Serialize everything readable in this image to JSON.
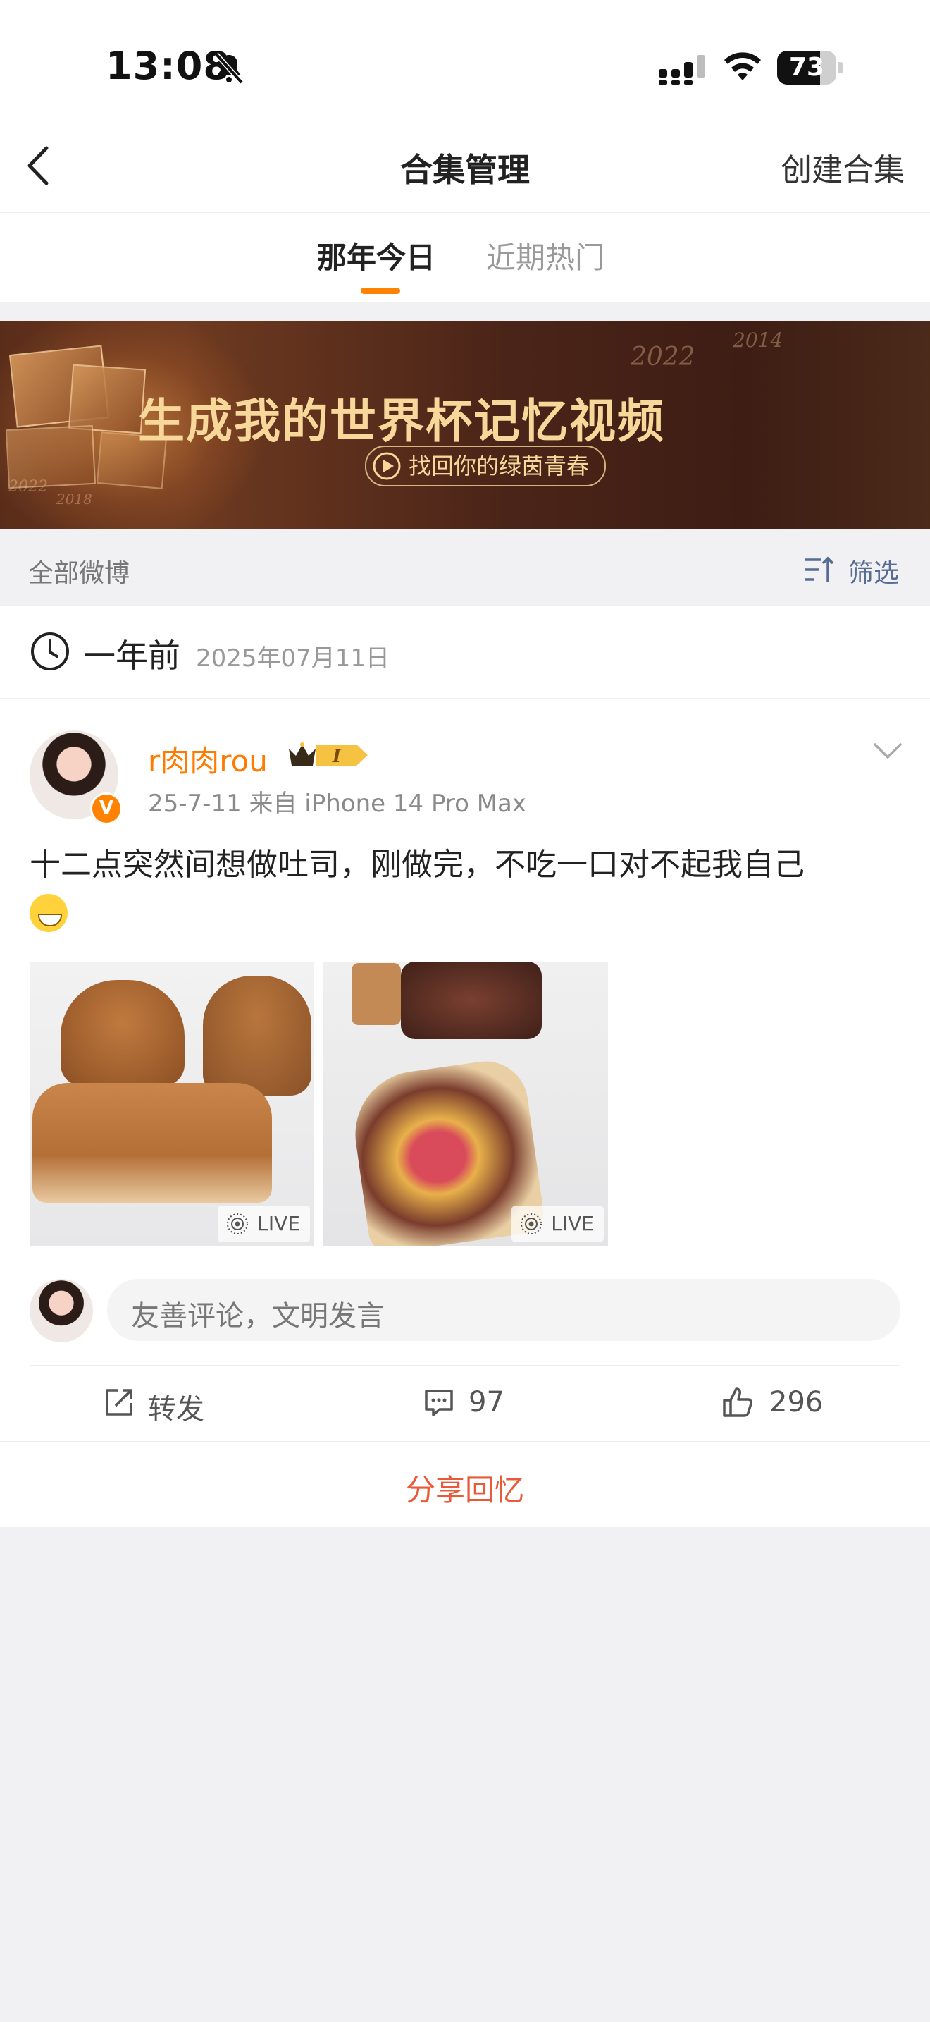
{
  "status_bar": {
    "time": "13:08",
    "battery": "73",
    "battery_level": 0.73,
    "icons": [
      "bell-mute-icon",
      "signal-icon",
      "wifi-icon",
      "battery-icon"
    ]
  },
  "nav": {
    "title": "合集管理",
    "right_action": "创建合集",
    "back_icon": "back-arrow-icon"
  },
  "tabs": [
    {
      "label": "那年今日",
      "active": true
    },
    {
      "label": "近期热门",
      "active": false
    }
  ],
  "banner": {
    "title": "生成我的世界杯记忆视频",
    "button": "找回你的绿茵青春",
    "years": [
      "2022",
      "2014",
      "2022",
      "2018"
    ]
  },
  "filter": {
    "left_label": "全部微博",
    "right_label": "筛选"
  },
  "time_header": {
    "ago": "一年前",
    "date": "2025年07月11日"
  },
  "post": {
    "username": "r肉肉rou",
    "verified_badge": "V",
    "level_badge": "I",
    "meta": "25-7-11  来自 iPhone 14 Pro Max",
    "text": "十二点突然间想做吐司，刚做完，不吃一口对不起我自己",
    "images": [
      {
        "badge": "LIVE"
      },
      {
        "badge": "LIVE"
      }
    ],
    "comment_placeholder": "友善评论，文明发言",
    "actions": {
      "repost": "转发",
      "comments": "97",
      "likes": "296"
    }
  },
  "share_button": "分享回忆",
  "colors": {
    "accent_orange": "#ff8200",
    "share_red": "#e85a3a",
    "filter_blue": "#566c93"
  }
}
